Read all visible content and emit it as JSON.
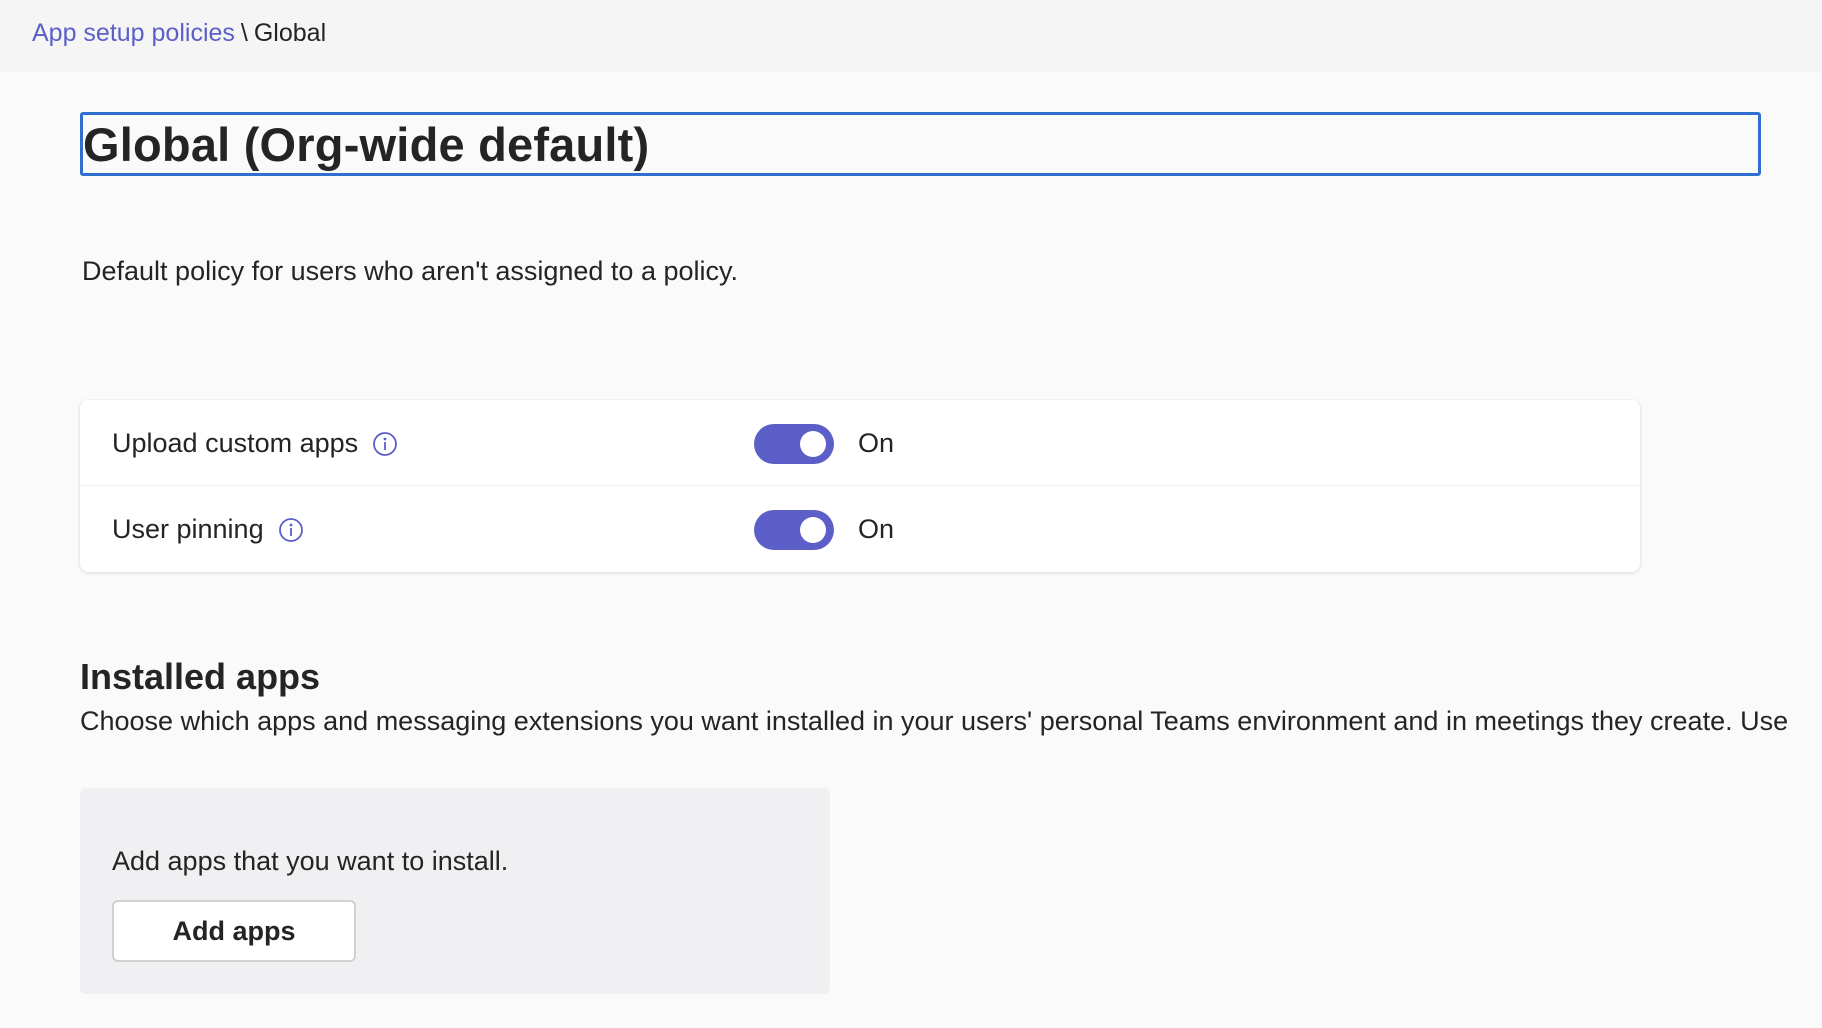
{
  "breadcrumb": {
    "parent": "App setup policies",
    "separator": "\\",
    "current": "Global"
  },
  "policy": {
    "name_value": "Global (Org-wide default)",
    "description": "Default policy for users who aren't assigned to a policy."
  },
  "settings": [
    {
      "label": "Upload custom apps",
      "icon": "info-icon",
      "enabled": true,
      "state_text": "On"
    },
    {
      "label": "User pinning",
      "icon": "info-icon",
      "enabled": true,
      "state_text": "On"
    }
  ],
  "installed_apps": {
    "title": "Installed apps",
    "description": "Choose which apps and messaging extensions you want installed in your users' personal Teams environment and in meetings they create. Use",
    "panel_text": "Add apps that you want to install.",
    "add_button_label": "Add apps"
  },
  "colors": {
    "accent": "#5b5fc7",
    "focus_border": "#2f6fcf",
    "background": "#fafafa",
    "card": "#ffffff"
  }
}
